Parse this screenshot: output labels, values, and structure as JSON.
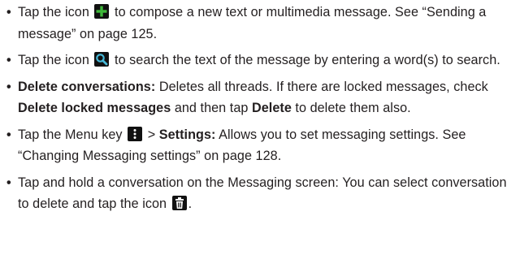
{
  "bullets": [
    {
      "prefix": "Tap the icon",
      "suffix": " to compose a new text or multimedia message. See “Sending a message” on page 125.",
      "icon": "plus-icon"
    },
    {
      "prefix": "Tap the icon",
      "suffix": " to search the text of the message by entering a word(s) to search.",
      "icon": "search-icon"
    },
    {
      "bold_lead": "Delete conversations:",
      "text_a": " Deletes all threads. If there are locked messages, check ",
      "bold_mid": "Delete locked messages",
      "text_b": " and then tap ",
      "bold_end": "Delete",
      "text_c": " to delete them also."
    },
    {
      "prefix": "Tap the Menu key",
      "middle": " > ",
      "bold": "Settings:",
      "suffix": " Allows you to set messaging settings. See “Changing Messaging settings” on page 128.",
      "icon": "menu-key-icon"
    },
    {
      "prefix": "Tap and hold a conversation on the Messaging screen: You can select conversation to delete and tap the icon",
      "suffix": ".",
      "icon": "trash-icon"
    }
  ],
  "colors": {
    "text": "#231f20",
    "icon_bg": "#111111",
    "plus_green": "#3fb83a",
    "search_teal": "#47b9d8"
  }
}
